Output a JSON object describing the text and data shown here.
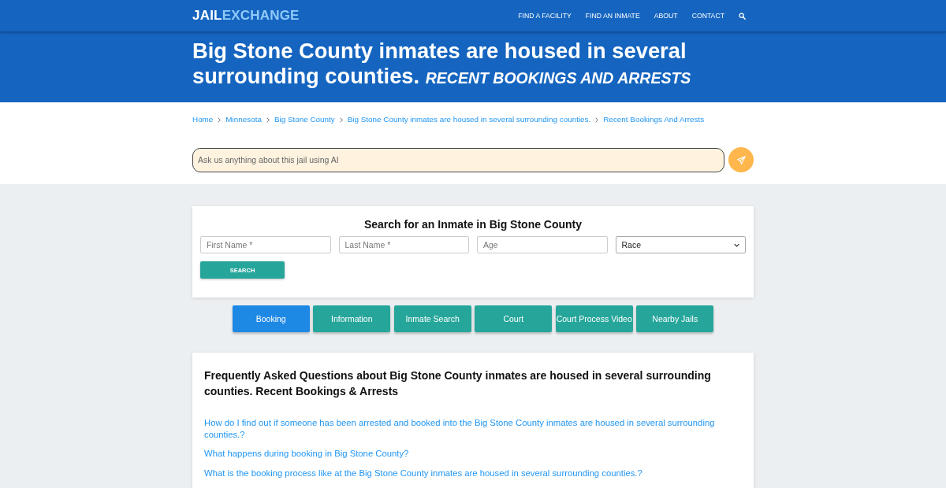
{
  "nav": {
    "logo": {
      "part_1": "JAIL",
      "part_2": "EXCHANGE"
    },
    "links": [
      "FIND A FACILITY",
      "FIND AN INMATE",
      "ABOUT",
      "CONTACT"
    ]
  },
  "hero": {
    "title": "Big Stone County inmates are housed in several surrounding counties.",
    "subtitle": "RECENT BOOKINGS AND ARRESTS"
  },
  "breadcrumb": [
    "Home",
    "Minnesota",
    "Big Stone County",
    "Big Stone County inmates are housed in several surrounding counties.",
    "Recent Bookings And Arrests"
  ],
  "ai_search": {
    "placeholder": "Ask us anything about this jail using AI"
  },
  "inmate_search": {
    "title": "Search for an Inmate in Big Stone County",
    "fields": [
      {
        "kind": "text",
        "placeholder": "First Name *"
      },
      {
        "kind": "text",
        "placeholder": "Last Name *"
      },
      {
        "kind": "text",
        "placeholder": "Age"
      },
      {
        "kind": "select",
        "value": "Race"
      }
    ],
    "button": "SEARCH"
  },
  "tabs": [
    {
      "label": "Booking",
      "selected": true
    },
    {
      "label": "Information",
      "selected": false
    },
    {
      "label": "Inmate Search",
      "selected": false
    },
    {
      "label": "Court",
      "selected": false
    },
    {
      "label": "Court Process Video",
      "selected": false
    },
    {
      "label": "Nearby Jails",
      "selected": false
    }
  ],
  "faq": {
    "title": "Frequently Asked Questions about Big Stone County inmates are housed in several surrounding counties. Recent Bookings & Arrests",
    "questions": [
      "How do I find out if someone has been arrested and booked into the Big Stone County inmates are housed in several surrounding counties.?",
      "What happens during booking in Big Stone County?",
      "What is the booking process like at the Big Stone County inmates are housed in several surrounding counties.?"
    ]
  }
}
